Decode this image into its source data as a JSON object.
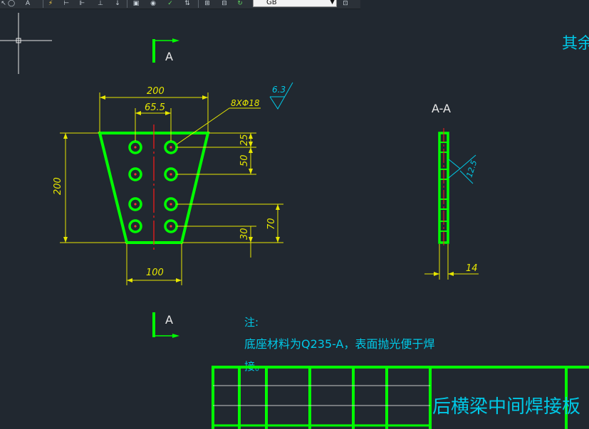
{
  "toolbar": {
    "icons": [
      "cursor-icon",
      "circle-icon",
      "text-style-icon",
      "lightning-icon",
      "dimension-linear-icon",
      "dimension-aligned-icon",
      "dimension-ordinate-icon",
      "dimension-radius-icon",
      "baseline-icon",
      "target-icon",
      "check-icon",
      "leader-icon",
      "box-icon",
      "box-2-icon",
      "refresh-icon",
      "style-icon"
    ],
    "standard_select": {
      "value": "GB"
    }
  },
  "drawing": {
    "top_right_text": "其余",
    "section_marker_label": "A",
    "section_view_label": "A-A",
    "dims": {
      "top_width": "200",
      "hole_spacing": "65.5",
      "height": "200",
      "bottom_width": "100",
      "v25": "25",
      "v50": "50",
      "v30": "30",
      "v70": "70",
      "thickness": "14"
    },
    "hole_callout": "8XΦ18",
    "roughness_main": "6.3",
    "roughness_section": "12.5",
    "notes": {
      "title": "注:",
      "line1": "底座材料为Q235-A，表面抛光便于焊",
      "line2": "接。"
    },
    "title_block": {
      "title": "后横梁中间焊接板"
    }
  },
  "colors": {
    "background": "#212830",
    "part_outline": "#00ff00",
    "dimension": "#e6e600",
    "annotation": "#00c8e6",
    "centerline": "#ff1a1a",
    "hole_center": "#ff3030"
  }
}
